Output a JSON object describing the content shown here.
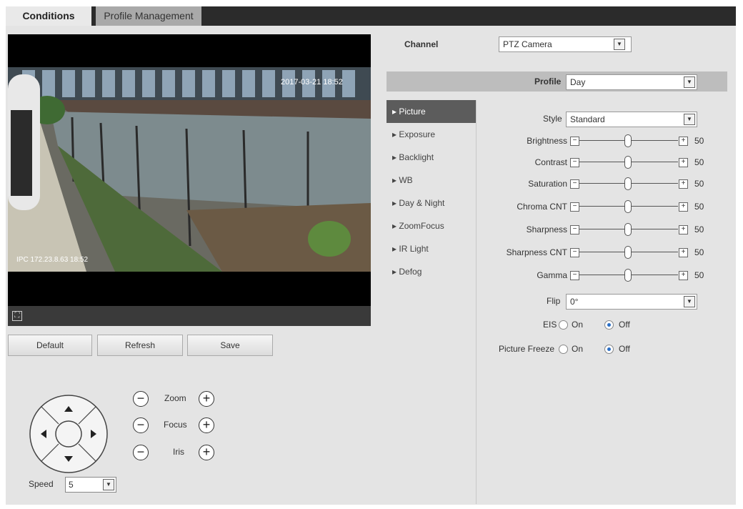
{
  "tabs": {
    "conditions": "Conditions",
    "profile_management": "Profile Management"
  },
  "video": {
    "osd_top": "2017-03-21 18:52",
    "osd_bottom": "IPC 172.23.8.63 18:52",
    "fullscreen_icon": "fullscreen-icon"
  },
  "buttons": {
    "default": "Default",
    "refresh": "Refresh",
    "save": "Save"
  },
  "ptz": {
    "zoom": "Zoom",
    "focus": "Focus",
    "iris": "Iris",
    "minus": "−",
    "plus": "+",
    "speed_label": "Speed",
    "speed_value": "5"
  },
  "channel": {
    "label": "Channel",
    "value": "PTZ Camera"
  },
  "profile": {
    "label": "Profile",
    "value": "Day"
  },
  "menu": [
    "Picture",
    "Exposure",
    "Backlight",
    "WB",
    "Day & Night",
    "ZoomFocus",
    "IR Light",
    "Defog"
  ],
  "picture": {
    "style_label": "Style",
    "style_value": "Standard",
    "sliders": [
      {
        "label": "Brightness",
        "value": 50
      },
      {
        "label": "Contrast",
        "value": 50
      },
      {
        "label": "Saturation",
        "value": 50
      },
      {
        "label": "Chroma CNT",
        "value": 50
      },
      {
        "label": "Sharpness",
        "value": 50
      },
      {
        "label": "Sharpness CNT",
        "value": 50
      },
      {
        "label": "Gamma",
        "value": 50
      }
    ],
    "flip_label": "Flip",
    "flip_value": "0°",
    "eis_label": "EIS",
    "eis_on": "On",
    "eis_off": "Off",
    "freeze_label": "Picture Freeze",
    "freeze_on": "On",
    "freeze_off": "Off"
  }
}
